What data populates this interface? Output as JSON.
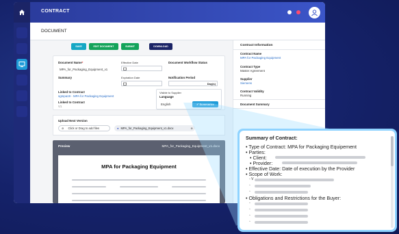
{
  "app": {
    "title": "CONTRACT",
    "page_heading": "DOCUMENT",
    "colors": {
      "save": "#15a7c4",
      "edit": "#13a35a",
      "submit": "#13a35a",
      "download": "#1b2466",
      "accent": "#1e9bd8"
    }
  },
  "toolbar": {
    "save_label": "SAVE",
    "edit_label": "EDIT DOCUMENT",
    "submit_label": "SUBMIT",
    "download_label": "DOWNLOAD"
  },
  "form": {
    "document_name_label": "Document Name",
    "required_mark": "*",
    "document_name_value": "MPA_for_Packaging_Equipment_v1",
    "effective_date_label": "Effective Date",
    "workflow_status_label": "Document Workflow Status",
    "summary_label": "Summary",
    "expiration_date_label": "Expiration Date",
    "notification_period_label": "Notification Period",
    "notification_unit": "Day(s)",
    "linked_contract_label": "Linked to Contract",
    "linked_contract_value": "sgmpa19 - MPA for Packaging Equipment",
    "linked_contract_label2": "Linked to Contract",
    "linked_contract_value2": "V1",
    "visible_supplier_label": "Visible to Supplier",
    "language_label": "Language",
    "language_value": "English",
    "summarize_label": "Summarize"
  },
  "upload": {
    "title": "Upload Next Version",
    "drop_label": "Click or Drag to add files",
    "file_chip": "MPA_for_Packaging_Equipment_v1.docx"
  },
  "preview": {
    "title": "Preview",
    "file_name": "MPA_for_Packaging_Equipment_v1.docx",
    "doc_heading": "MPA for Packaging Equipment"
  },
  "contract_info": {
    "heading": "Contract Information",
    "name_label": "Contract Name",
    "name_value": "MPA for Packaging Equipment",
    "type_label": "Contract Type",
    "type_value": "Master Agreement",
    "supplier_label": "Supplier",
    "supplier_value": "Siemens",
    "validity_label": "Contract Validity",
    "validity_value": "Running",
    "doc_summary_label": "Document Summary"
  },
  "summary_popup": {
    "title": "Summary of Contract:",
    "items": [
      "• Type of Contract: MPA for Packaging Equipement",
      "• Parties:",
      "• Client:",
      "• Provider:",
      "• Effective Date: Date of execution by the Provider",
      "• Scope of Work:",
      "• Obligations and Restrictions for the Buyer:"
    ],
    "sub_bullet": "◦",
    "sub_bullet_v": "◦ V"
  },
  "icons": [
    "home-icon",
    "notification-dot-icon",
    "alert-dot-icon",
    "user-avatar-icon",
    "calendar-icon",
    "paperclip-icon",
    "file-icon",
    "close-icon",
    "check-icon"
  ]
}
